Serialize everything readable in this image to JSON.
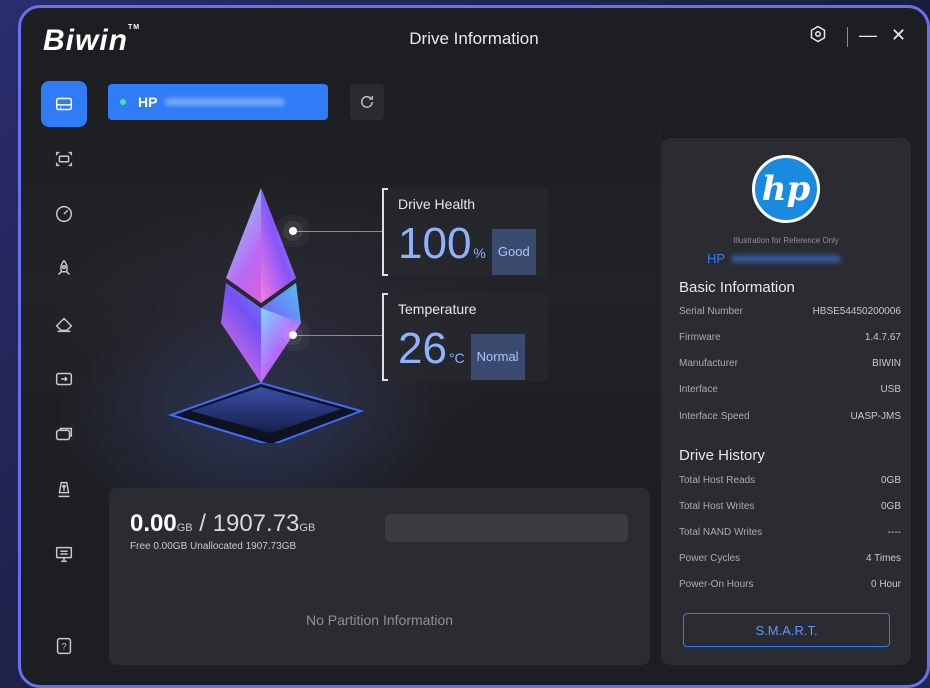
{
  "app": {
    "brand": "Biwin",
    "trademark": "TM",
    "title": "Drive Information"
  },
  "window_controls": {
    "settings": "⚙",
    "minimize": "—",
    "close": "✕"
  },
  "sidebar": {
    "items": [
      {
        "name": "drive-info",
        "icon": "drive-icon"
      },
      {
        "name": "scan",
        "icon": "scan-icon"
      },
      {
        "name": "benchmark",
        "icon": "speedometer-icon"
      },
      {
        "name": "boost",
        "icon": "rocket-icon"
      },
      {
        "name": "erase",
        "icon": "eraser-icon"
      },
      {
        "name": "migrate",
        "icon": "migrate-icon"
      },
      {
        "name": "clone",
        "icon": "clone-drive-icon"
      },
      {
        "name": "firmware",
        "icon": "firmware-upload-icon"
      },
      {
        "name": "system",
        "icon": "monitor-icon"
      },
      {
        "name": "help",
        "icon": "help-icon",
        "label": "?"
      }
    ]
  },
  "drive": {
    "name": "HP",
    "status_color": "#49e59a"
  },
  "health": {
    "label": "Drive Health",
    "value": "100",
    "unit": "%",
    "status": "Good"
  },
  "temperature": {
    "label": "Temperature",
    "value": "26",
    "unit": "°C",
    "status": "Normal"
  },
  "storage": {
    "used": "0.00",
    "used_unit": "GB",
    "separator": "/",
    "total": "1907.73",
    "total_unit": "GB",
    "sub": "Free 0.00GB  Unallocated 1907.73GB",
    "empty_message": "No Partition Information"
  },
  "info": {
    "logo_text": "hp",
    "reference_note": "Illustration for Reference Only",
    "model": "HP",
    "basic_title": "Basic Information",
    "basic": [
      {
        "label": "Serial Number",
        "value": "HBSE54450200006"
      },
      {
        "label": "Firmware",
        "value": "1.4.7.67"
      },
      {
        "label": "Manufacturer",
        "value": "BIWIN"
      },
      {
        "label": "Interface",
        "value": "USB"
      },
      {
        "label": "Interface Speed",
        "value": "UASP-JMS"
      }
    ],
    "history_title": "Drive History",
    "history": [
      {
        "label": "Total Host Reads",
        "value": "0GB"
      },
      {
        "label": "Total Host Writes",
        "value": "0GB"
      },
      {
        "label": "Total NAND Writes",
        "value": "----"
      },
      {
        "label": "Power Cycles",
        "value": "4 Times"
      },
      {
        "label": "Power-On Hours",
        "value": "0 Hour"
      }
    ],
    "smart_label": "S.M.A.R.T."
  },
  "colors": {
    "accent": "#2f7cf6",
    "frame": "#6a6ef0",
    "highlight": "#8fb2ff"
  }
}
